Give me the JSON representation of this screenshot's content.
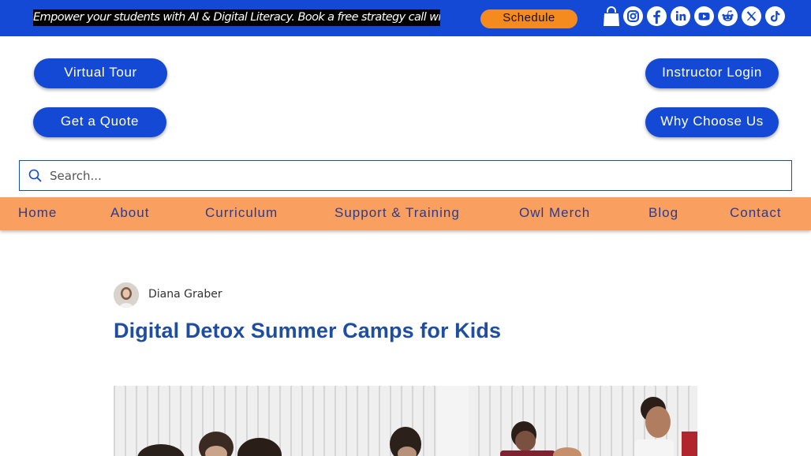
{
  "banner": {
    "promo_text": "Empower your students with AI & Digital Literacy. Book a free strategy call with our team!",
    "schedule_label": "Schedule"
  },
  "header_buttons": {
    "virtual_tour": "Virtual Tour",
    "get_quote": "Get a Quote",
    "instructor_login": "Instructor Login",
    "why_choose_us": "Why Choose Us"
  },
  "search": {
    "placeholder": "Search..."
  },
  "nav": {
    "items": [
      {
        "label": "Home"
      },
      {
        "label": "About"
      },
      {
        "label": "Curriculum"
      },
      {
        "label": "Support & Training"
      },
      {
        "label": "Owl Merch"
      },
      {
        "label": "Blog"
      },
      {
        "label": "Contact"
      }
    ]
  },
  "post": {
    "author": "Diana Graber",
    "title": "Digital Detox Summer Camps for Kids"
  },
  "social_icons": [
    "instagram-icon",
    "facebook-icon",
    "linkedin-icon",
    "youtube-icon",
    "reddit-icon",
    "x-icon",
    "tiktok-icon"
  ],
  "colors": {
    "brand_blue": "#1449d6",
    "nav_orange": "#f9a060",
    "schedule_orange": "#f58a1f",
    "title_blue": "#1f4ea1",
    "nav_text": "#2d3a8c"
  }
}
